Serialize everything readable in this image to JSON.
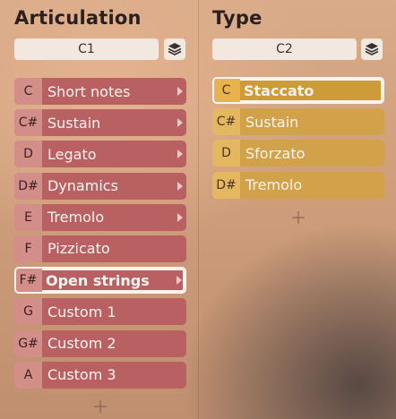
{
  "articulation": {
    "title": "Articulation",
    "selector_value": "C1",
    "layers_icon": "layers-icon",
    "items": [
      {
        "key": "C",
        "label": "Short notes",
        "has_submenu": true,
        "selected": false
      },
      {
        "key": "C#",
        "label": "Sustain",
        "has_submenu": true,
        "selected": false
      },
      {
        "key": "D",
        "label": "Legato",
        "has_submenu": true,
        "selected": false
      },
      {
        "key": "D#",
        "label": "Dynamics",
        "has_submenu": true,
        "selected": false
      },
      {
        "key": "E",
        "label": "Tremolo",
        "has_submenu": true,
        "selected": false
      },
      {
        "key": "F",
        "label": "Pizzicato",
        "has_submenu": false,
        "selected": false
      },
      {
        "key": "F#",
        "label": "Open strings",
        "has_submenu": true,
        "selected": true
      },
      {
        "key": "G",
        "label": "Custom 1",
        "has_submenu": false,
        "selected": false
      },
      {
        "key": "G#",
        "label": "Custom 2",
        "has_submenu": false,
        "selected": false
      },
      {
        "key": "A",
        "label": "Custom 3",
        "has_submenu": false,
        "selected": false
      }
    ],
    "add_icon": "plus-icon"
  },
  "type": {
    "title": "Type",
    "selector_value": "C2",
    "layers_icon": "layers-icon",
    "items": [
      {
        "key": "C",
        "label": "Staccato",
        "selected": true
      },
      {
        "key": "C#",
        "label": "Sustain",
        "selected": false
      },
      {
        "key": "D",
        "label": "Sforzato",
        "selected": false
      },
      {
        "key": "D#",
        "label": "Tremolo",
        "selected": false
      }
    ],
    "add_icon": "plus-icon"
  },
  "colors": {
    "articulation_row": "#b96063",
    "articulation_key": "#d48e8a",
    "type_row": "#d2a24a",
    "type_key": "#e4b860",
    "selected_outline": "#fbf3ee"
  }
}
